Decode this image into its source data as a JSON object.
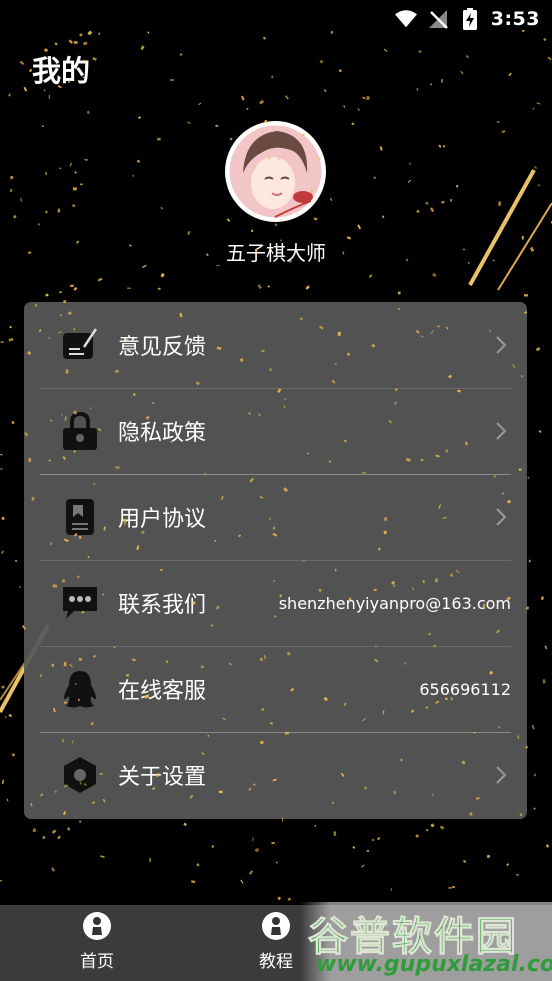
{
  "status_bar": {
    "time": "3:53"
  },
  "page": {
    "title": "我的"
  },
  "profile": {
    "username": "五子棋大师"
  },
  "menu": {
    "items": [
      {
        "label": "意见反馈",
        "value": "",
        "icon": "feedback-note-icon"
      },
      {
        "label": "隐私政策",
        "value": "",
        "icon": "lock-icon"
      },
      {
        "label": "用户协议",
        "value": "",
        "icon": "document-icon"
      },
      {
        "label": "联系我们",
        "value": "shenzhenyiyanpro@163.com",
        "icon": "chat-bubble-icon"
      },
      {
        "label": "在线客服",
        "value": "656696112",
        "icon": "qq-penguin-icon"
      },
      {
        "label": "关于设置",
        "value": "",
        "icon": "hexagon-settings-icon"
      }
    ]
  },
  "bottom_nav": {
    "tabs": [
      {
        "label": "首页",
        "icon": "chess-piece-icon"
      },
      {
        "label": "教程",
        "icon": "chess-piece-icon"
      }
    ]
  },
  "watermark": {
    "brand": "谷普软件园",
    "url": "www.gupuxlazal.com"
  },
  "colors": {
    "background": "#000000",
    "card": "#585858",
    "gold_confetti": "#e8b94a",
    "bottom_nav": "#3b3b3b",
    "watermark_green": "#2f9c3a"
  }
}
